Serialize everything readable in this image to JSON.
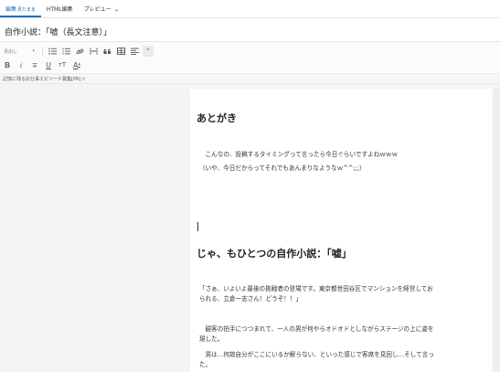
{
  "tabs": [
    {
      "label": "編集",
      "sub": "見たまま"
    },
    {
      "label": "HTML編集"
    },
    {
      "label": "プレビュー"
    }
  ],
  "title": "自作小説：「嘘（長文注意）」",
  "toolbar": {
    "format_select": "見出し",
    "icons": [
      "bullet-list-icon",
      "numbered-list-icon",
      "link-icon",
      "horizontal-rule-icon",
      "quote-icon",
      "table-icon",
      "align-icon",
      "collapse-icon",
      "bold-icon",
      "italic-icon",
      "strikethrough-icon",
      "underline-icon",
      "text-size-icon",
      "font-color-icon"
    ],
    "bold": "B",
    "italic": "i",
    "strike": "∓",
    "underline": "U",
    "textsize": "тT",
    "fontcolor": "A"
  },
  "tag": {
    "label": "記憶に残るお仕事エピソード募集[PR]",
    "close": "×"
  },
  "content": {
    "heading1": "あとがき",
    "p1": "　こんなの、投稿するタイミングって言ったら今日ぐらいですよねｗｗｗ",
    "p2": "（いや、今日だからってそれでもあんまりなようなｗ^^;;;）",
    "heading2": "じゃ、もひとつの自作小説：「嘘」",
    "p3a": "「さぁ、いよいよ最後の挑戦者の登場です。東京都世田谷区でマンションを経営してお",
    "p3b": "られる、立倉一志さん！どうぞ！！」",
    "p4a": "　観客の拍手につつまれて、一人の男が何やらオドオドとしながらステージの上に姿を",
    "p4b": "現した。",
    "p5a": "　男は…何故自分がここにいるか解らない、といった感じで客席を見回し…そして言っ",
    "p5b": "た。"
  }
}
